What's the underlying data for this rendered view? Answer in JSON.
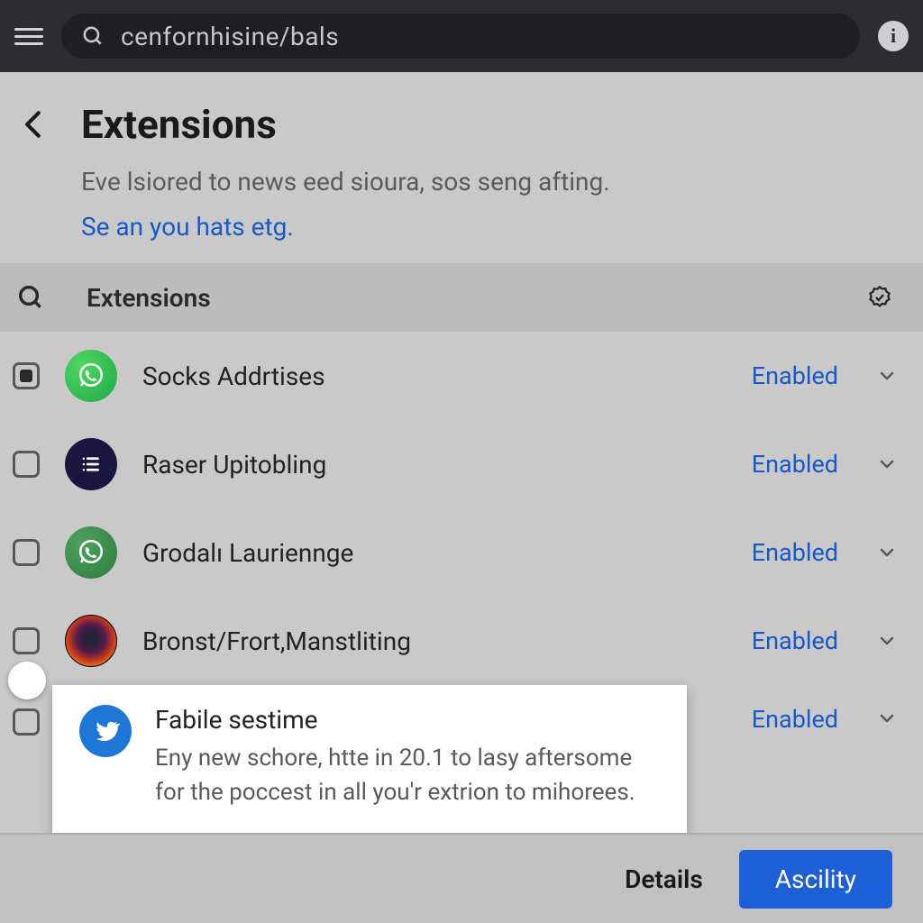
{
  "topbar": {
    "search_query": "cenfornhisine/bals"
  },
  "header": {
    "title": "Extensions",
    "subtitle": "Eve lsiored to news eed sioura, sos seng afting.",
    "link_text": "Se an you hats etg."
  },
  "list_section": {
    "label": "Extensions"
  },
  "extensions": [
    {
      "name": "Socks Addrtises",
      "status": "Enabled",
      "icon": "whatsapp",
      "checked": true
    },
    {
      "name": "Raser Upitobling",
      "status": "Enabled",
      "icon": "list",
      "checked": false
    },
    {
      "name": "Grodalı Lauriennge",
      "status": "Enabled",
      "icon": "whatsapp2",
      "checked": false
    },
    {
      "name": "Bronst/Frort,Manstliting",
      "status": "Enabled",
      "icon": "firefox",
      "checked": false
    },
    {
      "name": "Fabile sestime",
      "status": "Enabled",
      "icon": "twitter",
      "checked": false,
      "description": "Eny new schore, htte in 20.1 to lasy aftersome for the poccest in all you'r extrion to mihorees."
    }
  ],
  "actions": {
    "secondary": "Details",
    "primary": "Ascility"
  }
}
